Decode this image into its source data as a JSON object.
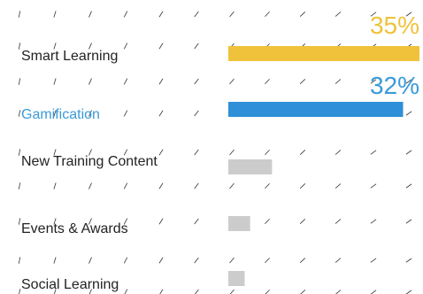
{
  "chart_data": {
    "type": "bar",
    "orientation": "horizontal",
    "categories": [
      "Smart Learning",
      "Gamification",
      "New Training Content",
      "Events & Awards",
      "Social Learning"
    ],
    "values": [
      35,
      32,
      8,
      4,
      3
    ],
    "value_labels": [
      "35%",
      "32%",
      "",
      "",
      ""
    ],
    "category_label_colors": [
      "#222222",
      "#3a9ad9",
      "#222222",
      "#222222",
      "#222222"
    ],
    "value_label_colors": [
      "#f0c23b",
      "#3a9ad9",
      "",
      "",
      ""
    ],
    "bar_colors": [
      "#f0c23b",
      "#2f8fd8",
      "#cccccc",
      "#cccccc",
      "#cccccc"
    ],
    "xlim": [
      0,
      35
    ],
    "background_pattern": "diagonal-dashes",
    "pattern_color": "#333333"
  }
}
